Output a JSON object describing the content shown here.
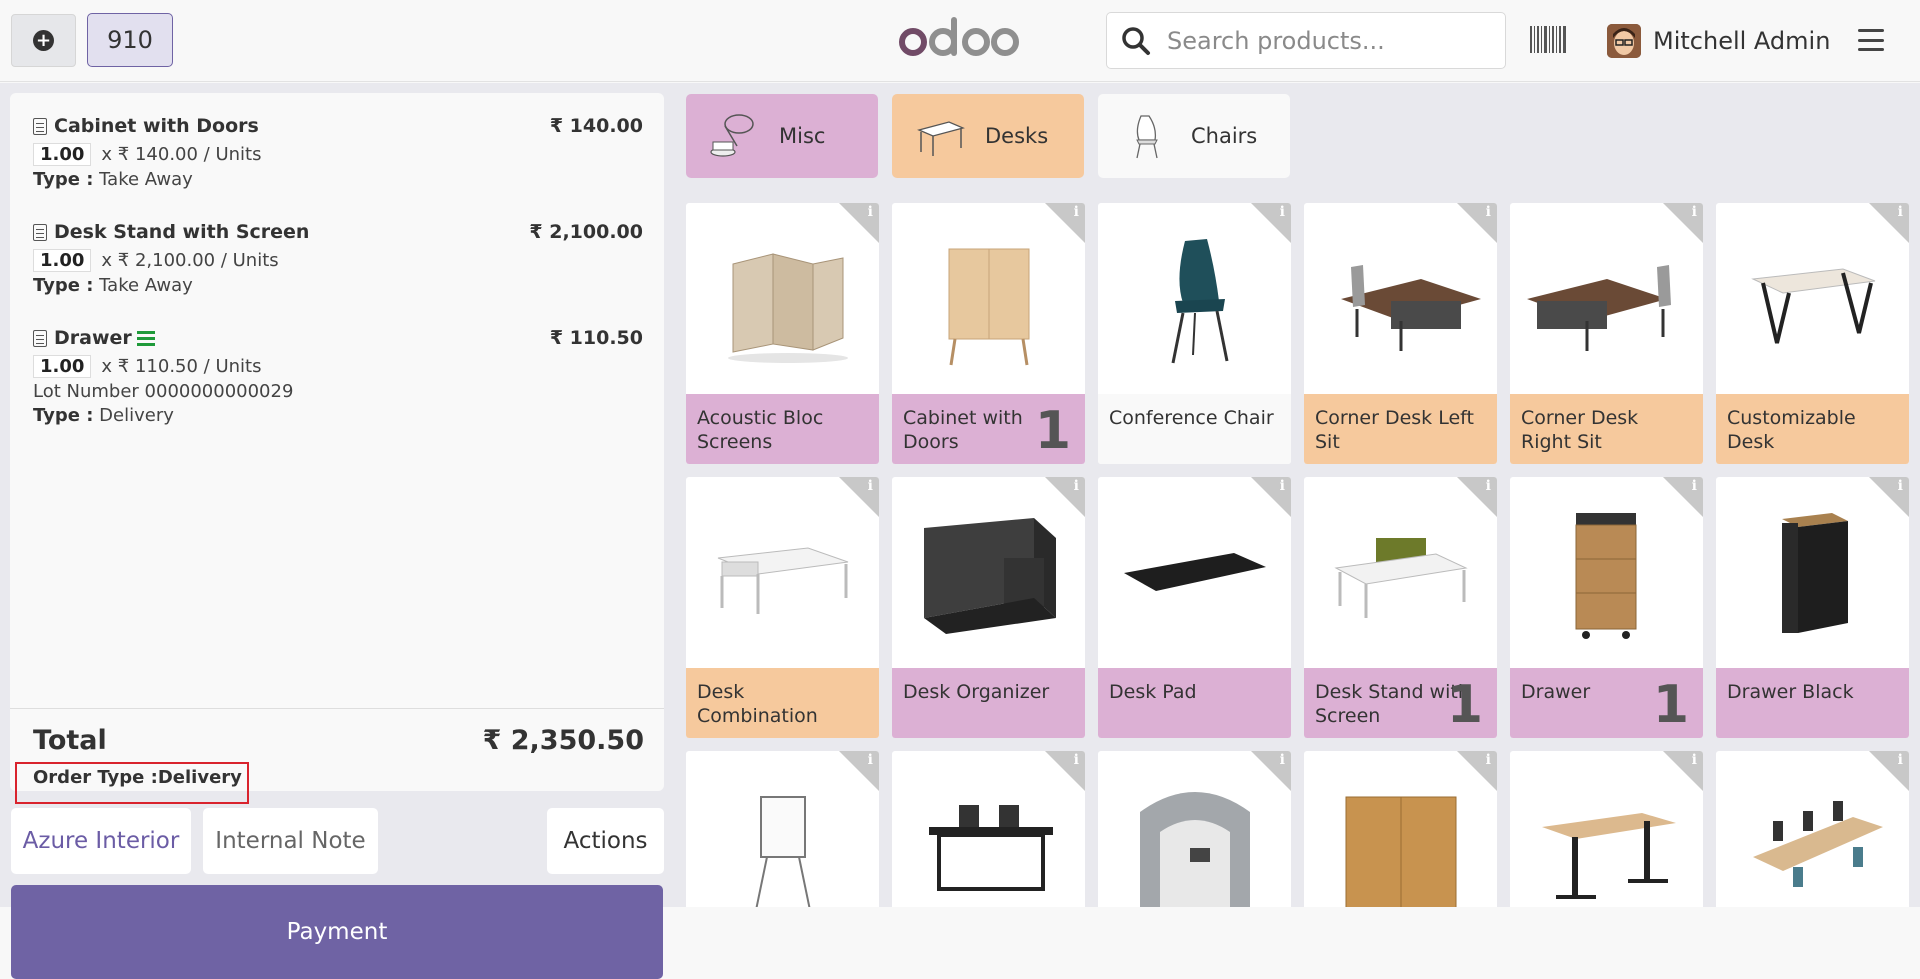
{
  "header": {
    "order_number": "910",
    "search_placeholder": "Search products...",
    "user_name": "Mitchell Admin"
  },
  "order": {
    "lines": [
      {
        "name": "Cabinet with Doors",
        "price": "₹ 140.00",
        "qty": "1.00",
        "unit": "x ₹ 140.00 / Units",
        "type_label": "Type :",
        "type_value": " Take Away"
      },
      {
        "name": "Desk Stand with Screen",
        "price": "₹ 2,100.00",
        "qty": "1.00",
        "unit": "x ₹ 2,100.00 / Units",
        "type_label": "Type :",
        "type_value": " Take Away"
      },
      {
        "name": "Drawer",
        "price": "₹ 110.50",
        "qty": "1.00",
        "unit": "x ₹ 110.50 / Units",
        "lot": "Lot Number 0000000000029",
        "type_label": "Type :",
        "type_value": " Delivery"
      }
    ],
    "total_label": "Total",
    "total_value": "₹ 2,350.50",
    "order_type": "Order Type :Delivery"
  },
  "buttons": {
    "customer": "Azure Interior",
    "note": "Internal Note",
    "actions": "Actions",
    "payment": "Payment"
  },
  "categories": [
    {
      "name": "Misc",
      "color": "#dcb0d4"
    },
    {
      "name": "Desks",
      "color": "#f6c99d"
    },
    {
      "name": "Chairs",
      "color": "#f9f9f9"
    }
  ],
  "products": [
    {
      "name": "Acoustic Bloc Screens",
      "category": "misc",
      "qty": ""
    },
    {
      "name": "Cabinet with Doors",
      "category": "misc",
      "qty": "1"
    },
    {
      "name": "Conference Chair",
      "category": "chairs",
      "qty": ""
    },
    {
      "name": "Corner Desk Left Sit",
      "category": "desks",
      "qty": ""
    },
    {
      "name": "Corner Desk Right Sit",
      "category": "desks",
      "qty": ""
    },
    {
      "name": "Customizable Desk",
      "category": "desks",
      "qty": ""
    },
    {
      "name": "Desk Combination",
      "category": "desks",
      "qty": ""
    },
    {
      "name": "Desk Organizer",
      "category": "misc",
      "qty": ""
    },
    {
      "name": "Desk Pad",
      "category": "misc",
      "qty": ""
    },
    {
      "name": "Desk Stand with Screen",
      "category": "misc",
      "qty": "1"
    },
    {
      "name": "Drawer",
      "category": "misc",
      "qty": "1"
    },
    {
      "name": "Drawer Black",
      "category": "misc",
      "qty": ""
    }
  ]
}
